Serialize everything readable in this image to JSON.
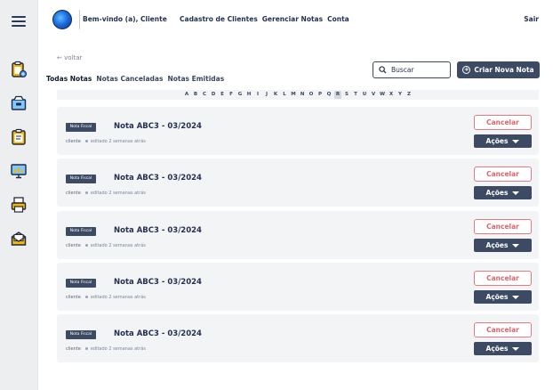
{
  "header": {
    "welcome": "Bem-vindo (a), Cliente",
    "nav": [
      "Cadastro de Clientes",
      "Gerenciar Notas",
      "Conta"
    ],
    "logout": "Sair"
  },
  "sidebar": {
    "items": [
      "clipboard-add-icon",
      "archive-icon",
      "clipboard-list-icon",
      "monitor-chart-icon",
      "printer-icon",
      "envelope-icon"
    ]
  },
  "page": {
    "back_label": "← voltar",
    "tabs": [
      "Todas Notas",
      "Notas Canceladas",
      "Notas Emitidas"
    ],
    "active_tab": "Todas Notas",
    "search_placeholder": "Buscar",
    "new_button": "Criar Nova Nota",
    "alphabet": [
      "A",
      "B",
      "C",
      "D",
      "E",
      "F",
      "G",
      "H",
      "I",
      "J",
      "K",
      "L",
      "M",
      "N",
      "O",
      "P",
      "Q",
      "R",
      "S",
      "T",
      "U",
      "V",
      "W",
      "X",
      "Y",
      "Z"
    ],
    "selected_letter": "R"
  },
  "notes": [
    {
      "badge": "Nota Fiscal",
      "title": "Nota ABC3 - 03/2024",
      "client": "cliente",
      "edited": "editado 2 semanas atrás",
      "cancel": "Cancelar",
      "actions": "Ações"
    },
    {
      "badge": "Nota Fiscal",
      "title": "Nota ABC3 - 03/2024",
      "client": "cliente",
      "edited": "editado 2 semanas atrás",
      "cancel": "Cancelar",
      "actions": "Ações"
    },
    {
      "badge": "Nota Fiscal",
      "title": "Nota ABC3 - 03/2024",
      "client": "cliente",
      "edited": "editado 2 semanas atrás",
      "cancel": "Cancelar",
      "actions": "Ações"
    },
    {
      "badge": "Nota Fiscal",
      "title": "Nota ABC3 - 03/2024",
      "client": "cliente",
      "edited": "editado 2 semanas atrás",
      "cancel": "Cancelar",
      "actions": "Ações"
    },
    {
      "badge": "Nota Fiscal",
      "title": "Nota ABC3 - 03/2024",
      "client": "cliente",
      "edited": "editado 2 semanas atrás",
      "cancel": "Cancelar",
      "actions": "Ações"
    }
  ],
  "colors": {
    "primary": "#3d4a64",
    "cancel": "#e0646b",
    "panel": "#f3f4f5",
    "sidebar": "#eceeef"
  }
}
